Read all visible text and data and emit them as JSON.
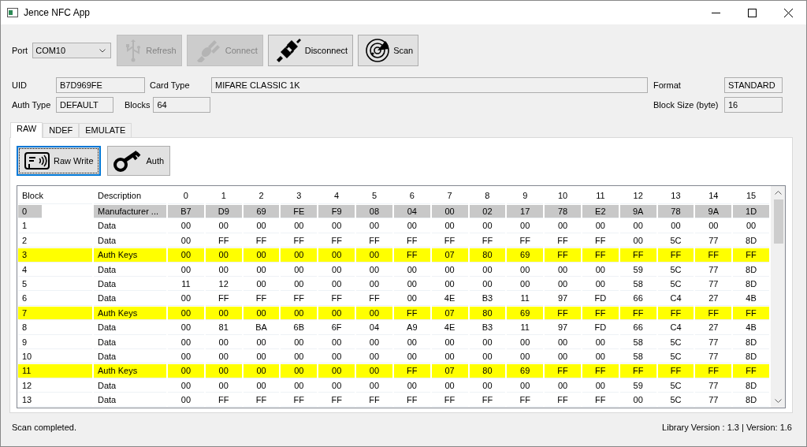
{
  "window": {
    "title": "Jence NFC App"
  },
  "toolbar": {
    "port_label": "Port",
    "port": "COM10",
    "buttons": [
      {
        "label": "Refresh",
        "kind": "usb",
        "disabled": true
      },
      {
        "label": "Connect",
        "kind": "plug",
        "disabled": true
      },
      {
        "label": "Disconnect",
        "kind": "unplug",
        "disabled": false
      },
      {
        "label": "Scan",
        "kind": "radar",
        "disabled": false
      }
    ]
  },
  "info": {
    "uid_label": "UID",
    "uid": "B7D969FE",
    "card_type_label": "Card Type",
    "card_type": "MIFARE CLASSIC 1K",
    "format_label": "Format",
    "format": "STANDARD",
    "auth_type_label": "Auth Type",
    "auth_type": "DEFAULT",
    "blocks_label": "Blocks",
    "blocks": "64",
    "block_size_label": "Block Size (byte)",
    "block_size": "16"
  },
  "tabs": [
    {
      "label": "RAW",
      "selected": true
    },
    {
      "label": "NDEF",
      "selected": false
    },
    {
      "label": "EMULATE",
      "selected": false
    }
  ],
  "actions": [
    {
      "label": "Raw Write",
      "kind": "card",
      "focused": true
    },
    {
      "label": "Auth",
      "kind": "key",
      "focused": false
    }
  ],
  "table": {
    "columns": [
      "Block",
      "Description",
      "0",
      "1",
      "2",
      "3",
      "4",
      "5",
      "6",
      "7",
      "8",
      "9",
      "10",
      "11",
      "12",
      "13",
      "14",
      "15"
    ],
    "rows": [
      {
        "block": "0",
        "description": "Manufacturer ...",
        "kind": "manufacturer",
        "bytes": [
          "B7",
          "D9",
          "69",
          "FE",
          "F9",
          "08",
          "04",
          "00",
          "02",
          "17",
          "78",
          "E2",
          "9A",
          "78",
          "9A",
          "1D"
        ]
      },
      {
        "block": "1",
        "description": "Data",
        "kind": "data",
        "bytes": [
          "00",
          "00",
          "00",
          "00",
          "00",
          "00",
          "00",
          "00",
          "00",
          "00",
          "00",
          "00",
          "00",
          "00",
          "00",
          "00"
        ]
      },
      {
        "block": "2",
        "description": "Data",
        "kind": "data",
        "bytes": [
          "00",
          "FF",
          "FF",
          "FF",
          "FF",
          "FF",
          "FF",
          "FF",
          "FF",
          "FF",
          "FF",
          "FF",
          "00",
          "5C",
          "77",
          "8D"
        ]
      },
      {
        "block": "3",
        "description": "Auth Keys",
        "kind": "auth",
        "bytes": [
          "00",
          "00",
          "00",
          "00",
          "00",
          "00",
          "FF",
          "07",
          "80",
          "69",
          "FF",
          "FF",
          "FF",
          "FF",
          "FF",
          "FF"
        ]
      },
      {
        "block": "4",
        "description": "Data",
        "kind": "data",
        "bytes": [
          "00",
          "00",
          "00",
          "00",
          "00",
          "00",
          "00",
          "00",
          "00",
          "00",
          "00",
          "00",
          "59",
          "5C",
          "77",
          "8D"
        ]
      },
      {
        "block": "5",
        "description": "Data",
        "kind": "data",
        "bytes": [
          "11",
          "12",
          "00",
          "00",
          "00",
          "00",
          "00",
          "00",
          "00",
          "00",
          "00",
          "00",
          "58",
          "5C",
          "77",
          "8D"
        ]
      },
      {
        "block": "6",
        "description": "Data",
        "kind": "data",
        "bytes": [
          "00",
          "FF",
          "FF",
          "FF",
          "FF",
          "FF",
          "00",
          "4E",
          "B3",
          "11",
          "97",
          "FD",
          "66",
          "C4",
          "27",
          "4B"
        ]
      },
      {
        "block": "7",
        "description": "Auth Keys",
        "kind": "auth",
        "bytes": [
          "00",
          "00",
          "00",
          "00",
          "00",
          "00",
          "FF",
          "07",
          "80",
          "69",
          "FF",
          "FF",
          "FF",
          "FF",
          "FF",
          "FF"
        ]
      },
      {
        "block": "8",
        "description": "Data",
        "kind": "data",
        "bytes": [
          "00",
          "81",
          "BA",
          "6B",
          "6F",
          "04",
          "A9",
          "4E",
          "B3",
          "11",
          "97",
          "FD",
          "66",
          "C4",
          "27",
          "4B"
        ]
      },
      {
        "block": "9",
        "description": "Data",
        "kind": "data",
        "bytes": [
          "00",
          "00",
          "00",
          "00",
          "00",
          "00",
          "00",
          "00",
          "00",
          "00",
          "00",
          "00",
          "58",
          "5C",
          "77",
          "8D"
        ]
      },
      {
        "block": "10",
        "description": "Data",
        "kind": "data",
        "bytes": [
          "00",
          "00",
          "00",
          "00",
          "00",
          "00",
          "00",
          "00",
          "00",
          "00",
          "00",
          "00",
          "58",
          "5C",
          "77",
          "8D"
        ]
      },
      {
        "block": "11",
        "description": "Auth Keys",
        "kind": "auth",
        "bytes": [
          "00",
          "00",
          "00",
          "00",
          "00",
          "00",
          "FF",
          "07",
          "80",
          "69",
          "FF",
          "FF",
          "FF",
          "FF",
          "FF",
          "FF"
        ]
      },
      {
        "block": "12",
        "description": "Data",
        "kind": "data",
        "bytes": [
          "00",
          "00",
          "00",
          "00",
          "00",
          "00",
          "00",
          "00",
          "00",
          "00",
          "00",
          "00",
          "59",
          "5C",
          "77",
          "8D"
        ]
      },
      {
        "block": "13",
        "description": "Data",
        "kind": "data",
        "bytes": [
          "00",
          "FF",
          "FF",
          "FF",
          "FF",
          "FF",
          "FF",
          "FF",
          "FF",
          "FF",
          "FF",
          "FF",
          "00",
          "5C",
          "77",
          "8D"
        ]
      }
    ]
  },
  "status_bar": {
    "message": "Scan completed.",
    "version": "Library Version : 1.3 | Version: 1.6"
  }
}
